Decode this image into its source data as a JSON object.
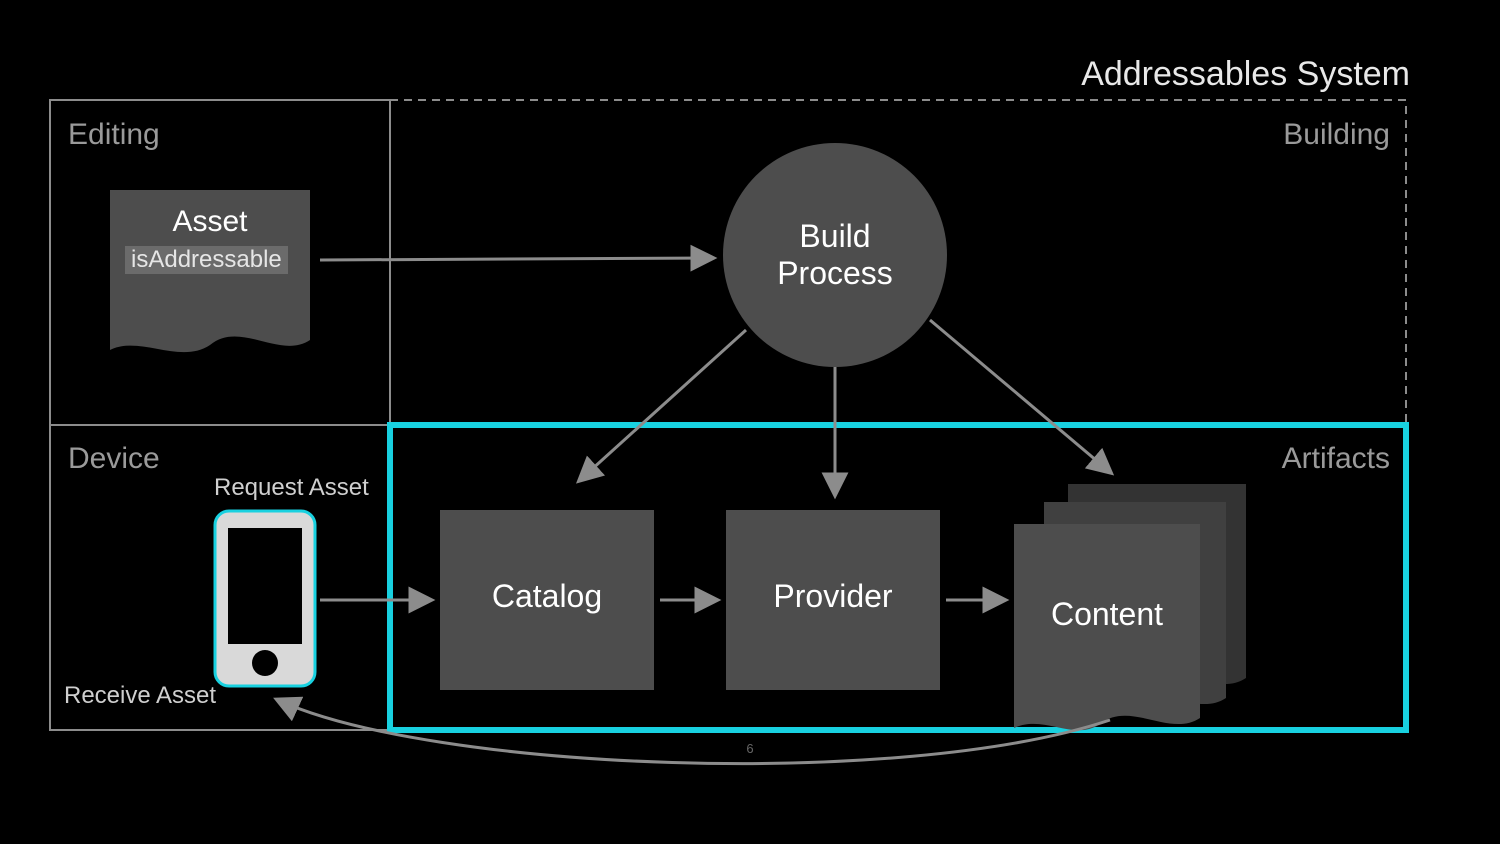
{
  "title": "Addressables System",
  "sections": {
    "editing": "Editing",
    "building": "Building",
    "device": "Device",
    "artifacts": "Artifacts"
  },
  "asset": {
    "title": "Asset",
    "tag": "isAddressable"
  },
  "build_process": "Build\nProcess",
  "catalog": "Catalog",
  "provider": "Provider",
  "content": "Content",
  "request_asset": "Request Asset",
  "receive_asset": "Receive Asset",
  "slide_number": "6",
  "colors": {
    "highlight": "#18d1e0",
    "node_fill": "#4d4d4d",
    "line": "#8c8c8c",
    "text_light": "#ffffff",
    "text_dim": "#bfbfbf"
  }
}
